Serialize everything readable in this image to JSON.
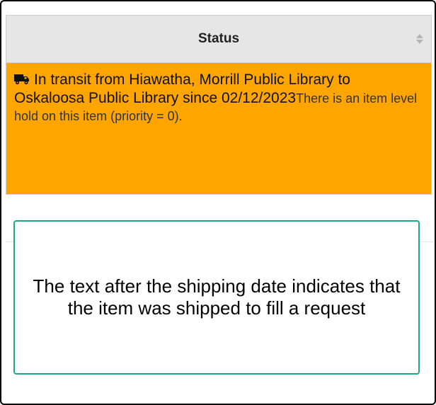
{
  "table": {
    "header": {
      "label": "Status",
      "sort_icon": "sort-both-arrows-icon"
    },
    "row": {
      "icon": "truck-icon",
      "status_text": "In transit from Hiawatha, Morrill Public Library to Oskaloosa Public Library since 02/12/2023",
      "hold_text": "There is an item level hold on this item (priority = 0).",
      "background_color": "#ffa500"
    }
  },
  "callout": {
    "text": "The text after the shipping date indicates that the item was shipped to fill a request",
    "border_color": "#1aaa8a"
  }
}
